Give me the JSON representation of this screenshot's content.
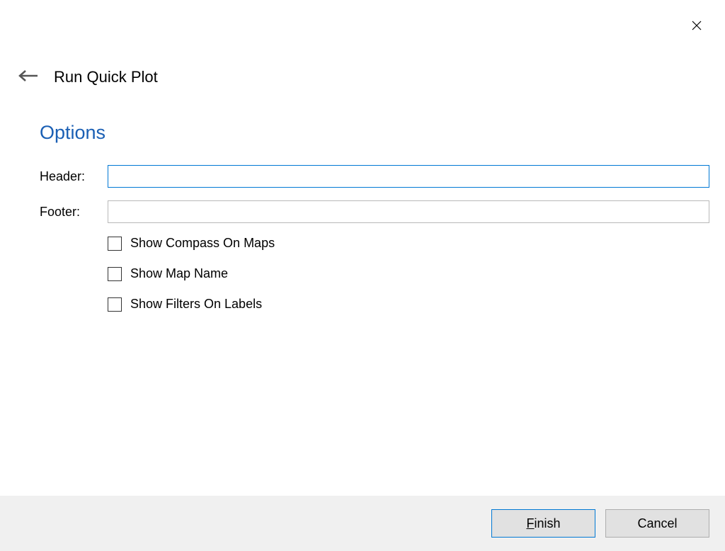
{
  "window": {
    "title": "Run Quick Plot"
  },
  "section": {
    "title": "Options"
  },
  "form": {
    "header_label": "Header:",
    "header_value": "",
    "footer_label": "Footer:",
    "footer_value": ""
  },
  "checkboxes": {
    "compass": {
      "label": "Show Compass On Maps",
      "checked": false
    },
    "mapname": {
      "label": "Show Map Name",
      "checked": false
    },
    "filters": {
      "label": "Show Filters On Labels",
      "checked": false
    }
  },
  "buttons": {
    "finish": "Finish",
    "cancel": "Cancel"
  }
}
